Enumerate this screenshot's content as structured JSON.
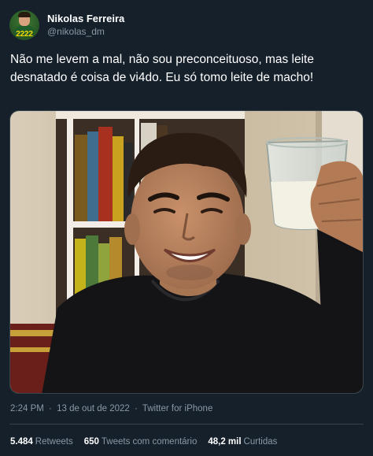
{
  "author": {
    "display_name": "Nikolas Ferreira",
    "handle": "@nikolas_dm",
    "avatar_badge": "2222"
  },
  "tweet": {
    "text": "Não me levem a mal, não sou preconceituoso, mas leite desnatado é coisa de vi4do. Eu só tomo leite de macho!",
    "time": "2:24 PM",
    "date": "13 de out de 2022",
    "separator": "·",
    "source": "Twitter for iPhone"
  },
  "stats": [
    {
      "value": "5.484",
      "label": "Retweets"
    },
    {
      "value": "650",
      "label": "Tweets com comentário"
    },
    {
      "value": "48,2 mil",
      "label": "Curtidas"
    }
  ],
  "colors": {
    "background": "#15202b",
    "text_primary": "#ffffff",
    "text_secondary": "#8b98a5",
    "border": "#38444d"
  }
}
